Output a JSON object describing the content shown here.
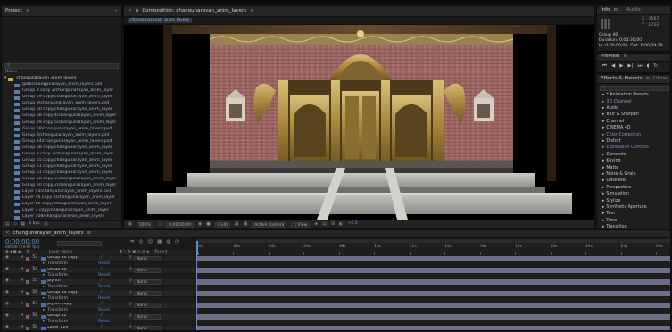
{
  "project": {
    "tab_title": "Project",
    "search_placeholder": "",
    "name_col": "Name",
    "root_folder": "changunarayan_anim_layers",
    "items": [
      "gate/changunarayan_anim_layers.psd",
      "Group 3 copy 2/changunarayan_anim_layer",
      "Group 59 copy/changunarayan_anim_layer",
      "Group 9/changunarayan_anim_layers.psd",
      "Group 60 copy/changunarayan_anim_layer",
      "Group 58 copy 4/changunarayan_anim_layer",
      "Group 59 copy 5/changunarayan_anim_layer",
      "Group 58/changunarayan_anim_layers.psd",
      "Group 3/changunarayan_anim_layers.psd",
      "Group 14/changunarayan_anim_layers.psd",
      "Group 58 copy/changunarayan_anim_layer",
      "Group 3 copy 3/changunarayan_anim_layer",
      "Group 55 copy/changunarayan_anim_layer",
      "Group 51 copy/changunarayan_anim_layer",
      "Group 61 copy/changunarayan_anim_layer",
      "Group 58 copy 2/changunarayan_anim_layer",
      "Group 60 copy 2/changunarayan_anim_layer",
      "Layer 45/changunarayan_anim_layers.psd",
      "Layer 46 copy 2/changunarayan_anim_layer",
      "Layer 66 copy/changunarayan_anim_layer",
      "Layer 1 copy/changunarayan_anim_layer",
      "Layer 108/changunarayan_anim_layers",
      "Layer 1 ... copy 5/changunarayan_anim_layer"
    ],
    "bpc": "8 bpc"
  },
  "composition": {
    "tab_title": "Composition: changunarayan_anim_layers",
    "comp_tab": "changunarayan_anim_layers",
    "zoom": "100%",
    "timecode": "0;00;00;00",
    "resolution": "(Full)",
    "camera": "Active Camera",
    "views": "1 View",
    "exposure": "+0.0"
  },
  "info": {
    "tab_info": "Info",
    "tab_audio": "Audio",
    "x_label": "X : 1567",
    "y_label": "Y : 1733",
    "layer_name": "Group 40",
    "duration": "Duration: 0;00;30;00",
    "in_out": "In: 0;00;00;00, Out: 0;00;29;29"
  },
  "preview": {
    "tab_title": "Preview"
  },
  "effects": {
    "tab_title": "Effects & Presets",
    "tab_libraries": "Librar",
    "search_placeholder": "",
    "items": [
      "* Animation Presets",
      "3D Channel",
      "Audio",
      "Blur & Sharpen",
      "Channel",
      "CINEMA 4D",
      "Color Correction",
      "Distort",
      "Expression Controls",
      "Generate",
      "Keying",
      "Matte",
      "Noise & Grain",
      "Obsolete",
      "Perspective",
      "Simulation",
      "Stylize",
      "Synthetic Aperture",
      "Text",
      "Time",
      "Transition",
      "Utility"
    ]
  },
  "timeline": {
    "tab_title": "changunarayan_anim_layers",
    "timecode": "0;00;00;00",
    "frames": "00000 (29.97 fps)",
    "col_layer_name": "Layer Name",
    "col_parent": "Parent",
    "ruler": [
      "0s",
      "02s",
      "04s",
      "06s",
      "08s",
      "10s",
      "12s",
      "14s",
      "16s",
      "18s",
      "20s",
      "22s",
      "24s",
      "26s"
    ],
    "rows": [
      {
        "type": "layer",
        "num": "53",
        "name": "Group 40 copy",
        "parent": "None"
      },
      {
        "type": "transform",
        "name": "Transform",
        "reset": "Reset"
      },
      {
        "type": "layer",
        "num": "54",
        "name": "Group 40",
        "parent": "None"
      },
      {
        "type": "transform",
        "name": "Transform",
        "reset": "Reset"
      },
      {
        "type": "layer",
        "num": "55",
        "name": "plynth",
        "parent": "None"
      },
      {
        "type": "transform",
        "name": "Transform",
        "reset": "Reset"
      },
      {
        "type": "layer",
        "num": "56",
        "name": "Group 54 copy",
        "parent": "None"
      },
      {
        "type": "transform",
        "name": "Transform",
        "reset": "Reset"
      },
      {
        "type": "layer",
        "num": "57",
        "name": "plynth copy",
        "parent": "None"
      },
      {
        "type": "transform",
        "name": "Transform",
        "reset": "Reset"
      },
      {
        "type": "layer",
        "num": "58",
        "name": "Group 42",
        "parent": "None"
      },
      {
        "type": "transform",
        "name": "Transform",
        "reset": "Reset"
      },
      {
        "type": "layer",
        "num": "59",
        "name": "Layer 219",
        "parent": "None"
      }
    ]
  }
}
